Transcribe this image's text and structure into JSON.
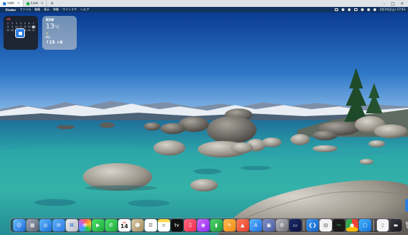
{
  "viewer": {
    "tabs": [
      {
        "label": "tobi",
        "close": "×"
      },
      {
        "label": "Live",
        "close": "×"
      }
    ],
    "add_tab": "+",
    "controls": [
      "–",
      "□",
      "×"
    ]
  },
  "menubar": {
    "apple": "",
    "app_name": "Finder",
    "items": [
      "ファイル",
      "編集",
      "表示",
      "移動",
      "ウインドウ",
      "ヘルプ"
    ],
    "datetime": "3月14日(土) 17:03"
  },
  "calendar_widget": {
    "month": "3月",
    "days": [
      "1",
      "2",
      "3",
      "4",
      "5",
      "6",
      "7",
      "8",
      "9",
      "10",
      "11",
      "12",
      "13",
      "14",
      "15",
      "16",
      "17",
      "18",
      "19",
      "20",
      "21"
    ],
    "today": "14"
  },
  "weather_widget": {
    "city": "東京都",
    "temp": "13",
    "unit": "°C",
    "icon": "☀",
    "condition": "晴れ",
    "range": "↑15 ↓6"
  },
  "dock": {
    "calendar_day": "14",
    "calendar_month": "3月"
  },
  "colors": {
    "accent": "#2b7de1",
    "menubar": "#123460"
  }
}
